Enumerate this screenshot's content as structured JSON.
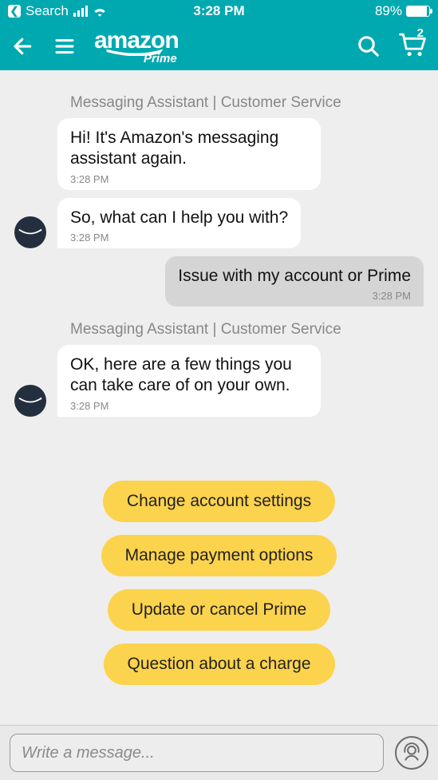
{
  "status": {
    "search_label": "Search",
    "time": "3:28 PM",
    "battery_pct": "89%"
  },
  "header": {
    "logo_main": "amazon",
    "logo_sub": "Prime",
    "cart_count": "2"
  },
  "chat": {
    "groups": [
      {
        "label": "Messaging Assistant | Customer Service",
        "messages": [
          {
            "text": "Hi! It's Amazon's messaging assistant again.",
            "time": "3:28 PM"
          },
          {
            "text": "So, what can I help you with?",
            "time": "3:28 PM"
          }
        ]
      }
    ],
    "user_message": {
      "text": "Issue with my account or Prime",
      "time": "3:28 PM"
    },
    "group2": {
      "label": "Messaging Assistant | Customer Service",
      "message": {
        "text": "OK, here are a few things you can take care of on your own.",
        "time": "3:28 PM"
      }
    }
  },
  "quick_replies": [
    "Change account settings",
    "Manage payment options",
    "Update or cancel Prime",
    "Question about a charge"
  ],
  "composer": {
    "placeholder": "Write a message..."
  }
}
